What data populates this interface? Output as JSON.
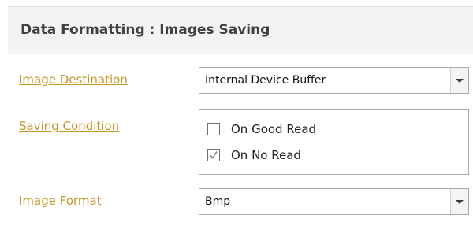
{
  "header": {
    "title": "Data Formatting :  Images Saving"
  },
  "fields": {
    "image_destination": {
      "label": "Image Destination",
      "value": "Internal Device Buffer"
    },
    "saving_condition": {
      "label": "Saving Condition",
      "options": [
        {
          "label": "On Good Read",
          "checked": false
        },
        {
          "label": "On No Read",
          "checked": true
        }
      ]
    },
    "image_format": {
      "label": "Image Format",
      "value": "Bmp"
    }
  },
  "colors": {
    "label_link": "#c79628",
    "header_bg": "#f3f3f3",
    "border": "#a8a8a8"
  },
  "icons": {
    "dropdown": "chevron-down-icon",
    "check": "check-icon"
  }
}
